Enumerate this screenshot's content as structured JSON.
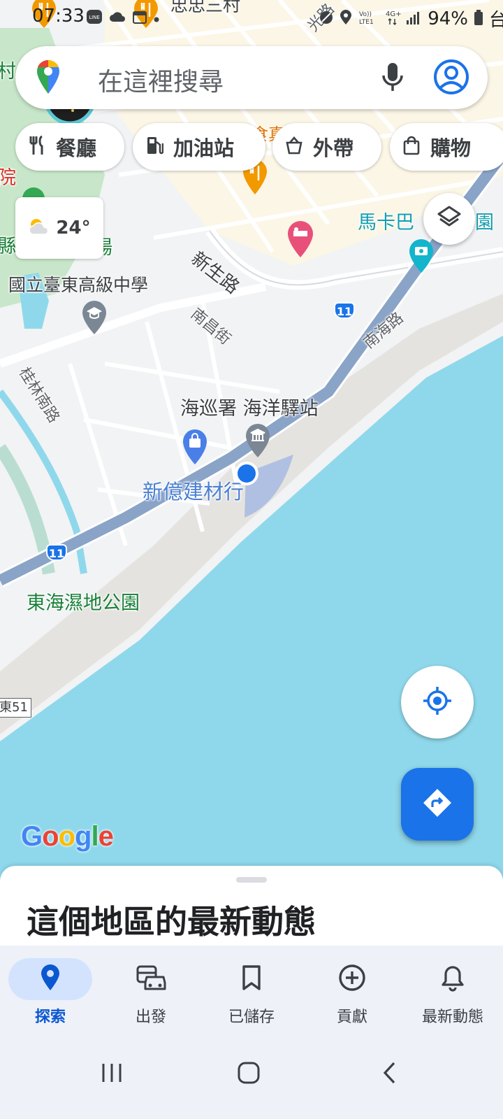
{
  "status_bar": {
    "time": "07:33",
    "battery": "94%",
    "truncated_right": "台"
  },
  "search": {
    "placeholder": "在這裡搜尋"
  },
  "chips": [
    {
      "label": "餐廳",
      "icon": "restaurant-icon"
    },
    {
      "label": "加油站",
      "icon": "gas-station-icon"
    },
    {
      "label": "外帶",
      "icon": "takeout-icon"
    },
    {
      "label": "購物",
      "icon": "shopping-bag-icon"
    }
  ],
  "weather": {
    "temp": "24°",
    "icon": "partly-cloudy-icon"
  },
  "map": {
    "labels": {
      "top_village": "忠忠三村",
      "top_road": "光路",
      "food_label": "食真",
      "makaba": "馬卡巴",
      "makaba_tail": "園",
      "xinsheng": "新生路",
      "school": "國立臺東高級中學",
      "nanchang": "南昌街",
      "nanhai": "南海路",
      "guilin": "桂林南路",
      "coast_guard": "海巡署 海洋驛站",
      "building_store": "新億建材行",
      "wetland_park": "東海濕地公園",
      "left_edge_1": "村",
      "left_edge_2": "院",
      "left_edge_3": "縣",
      "left_edge_4": "場"
    },
    "highway_number": "11",
    "route_sign": "東51",
    "colors": {
      "water": "#8fd8eb",
      "land": "#f1f3f4",
      "highway": "#8aa4c8",
      "park": "#c2e7c9",
      "accent": "#1a73e8"
    }
  },
  "google_logo": {
    "letters": [
      "G",
      "o",
      "o",
      "g",
      "l",
      "e"
    ]
  },
  "sheet": {
    "title": "這個地區的最新動態"
  },
  "bottom_nav": [
    {
      "label": "探索",
      "icon": "explore-pin-icon",
      "active": true
    },
    {
      "label": "出發",
      "icon": "commute-icon",
      "active": false
    },
    {
      "label": "已儲存",
      "icon": "bookmark-icon",
      "active": false
    },
    {
      "label": "貢獻",
      "icon": "add-circle-icon",
      "active": false
    },
    {
      "label": "最新動態",
      "icon": "bell-icon",
      "active": false
    }
  ]
}
